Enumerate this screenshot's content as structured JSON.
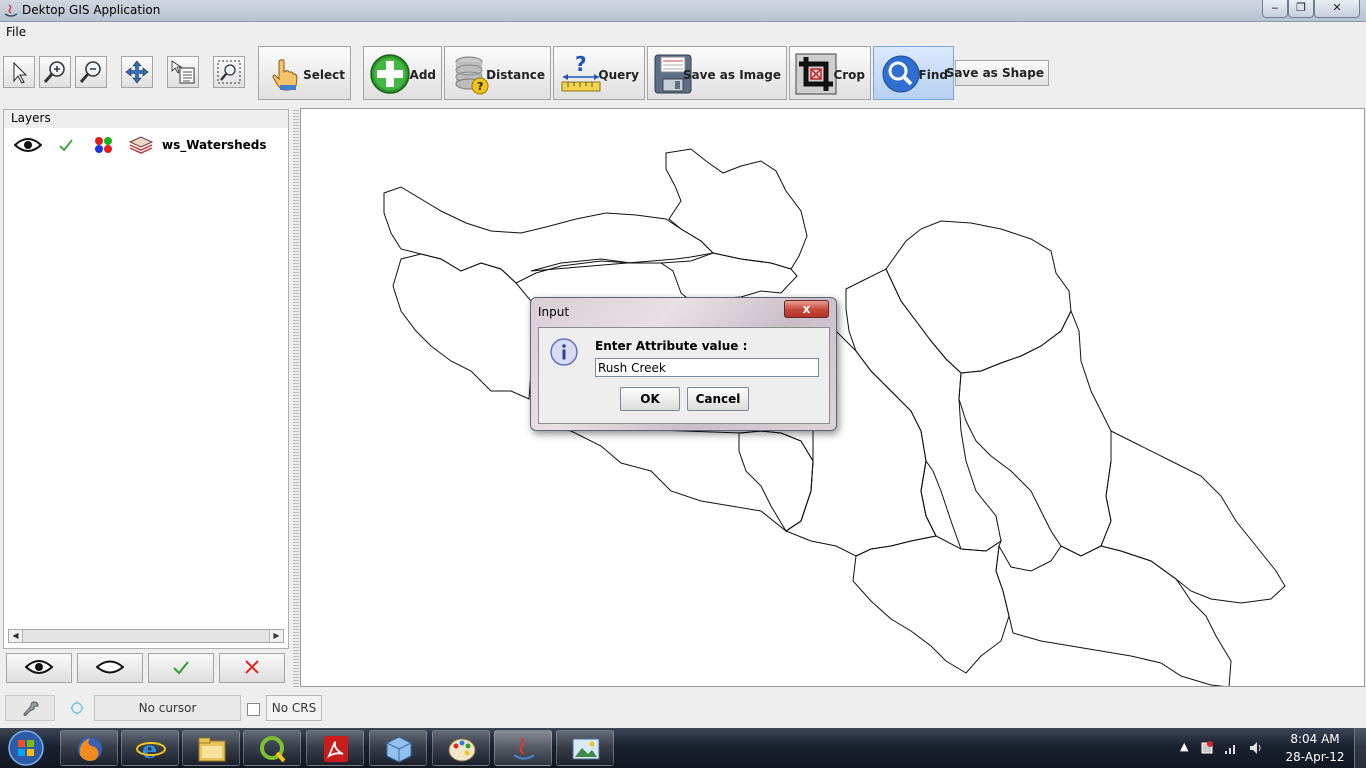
{
  "window": {
    "title": "Dektop GIS Application",
    "minimize": "‒",
    "maximize": "❐",
    "close": "✕"
  },
  "menu": {
    "file": "File"
  },
  "toolbar": {
    "select": "Select",
    "add": "Add",
    "distance": "Distance",
    "query": "Query",
    "save_image": "Save as Image",
    "crop": "Crop",
    "find": "Find",
    "save_shape": "Save as Shape"
  },
  "layers": {
    "title": "Layers",
    "items": [
      {
        "name": "ws_Watersheds",
        "visible": true,
        "selected": true
      }
    ]
  },
  "status": {
    "cursor": "No cursor",
    "crs": "No CRS"
  },
  "dialog": {
    "title": "Input",
    "prompt": "Enter Attribute value :",
    "value": "Rush Creek",
    "ok": "OK",
    "cancel": "Cancel",
    "close": "x"
  },
  "taskbar": {
    "time": "8:04 AM",
    "date": "28-Apr-12",
    "apps": [
      "firefox-icon",
      "internet-explorer-icon",
      "file-explorer-icon",
      "qgis-icon",
      "pdf-reader-icon",
      "3d-box-icon",
      "paint-icon",
      "java-icon",
      "image-viewer-icon"
    ]
  },
  "colors": {
    "accent": "#3b78d8",
    "find_active": "#b6d0f1",
    "map_bg": "#ffffff"
  }
}
